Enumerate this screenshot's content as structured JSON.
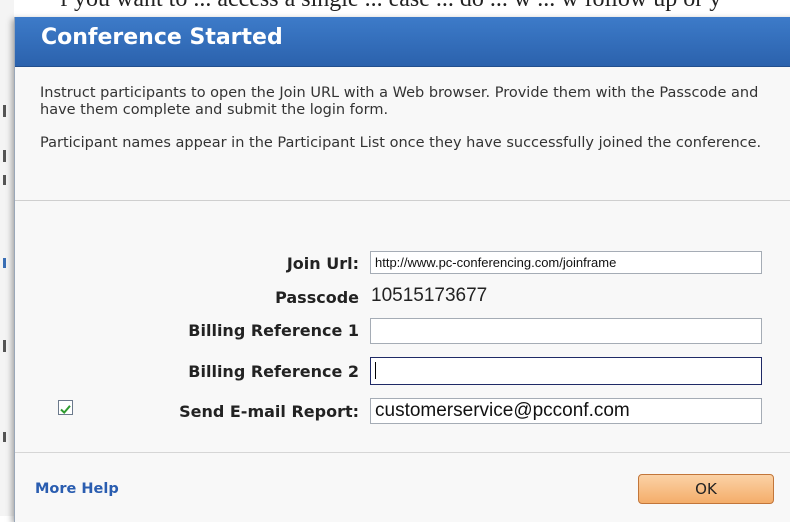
{
  "background": {
    "text": "f you want to ... access a single ... ease ... do ... w ... w follow up or y"
  },
  "dialog": {
    "title": "Conference Started",
    "instructions": [
      "Instruct participants to open the Join URL with a Web browser. Provide them with the Passcode and have them complete and submit the login form.",
      "Participant names appear in the Participant List once they have successfully joined the conference."
    ],
    "join_url": {
      "label": "Join Url:",
      "value": "http://www.pc-conferencing.com/joinframe"
    },
    "passcode": {
      "label": "Passcode",
      "value": "10515173677"
    },
    "billing_ref_1": {
      "label": "Billing Reference 1",
      "value": ""
    },
    "billing_ref_2": {
      "label": "Billing Reference 2",
      "value": ""
    },
    "email_report": {
      "label": "Send E-mail Report:",
      "checked": true,
      "value": "customerservice@pcconf.com"
    },
    "more_help": "More Help",
    "ok": "OK"
  },
  "colors": {
    "title_bar": "#3470be",
    "link": "#2a5db0",
    "ok_button": "#f6bb80",
    "checkmark": "#2e9b2e"
  },
  "icons": {
    "checkbox": "checkmark-icon"
  }
}
